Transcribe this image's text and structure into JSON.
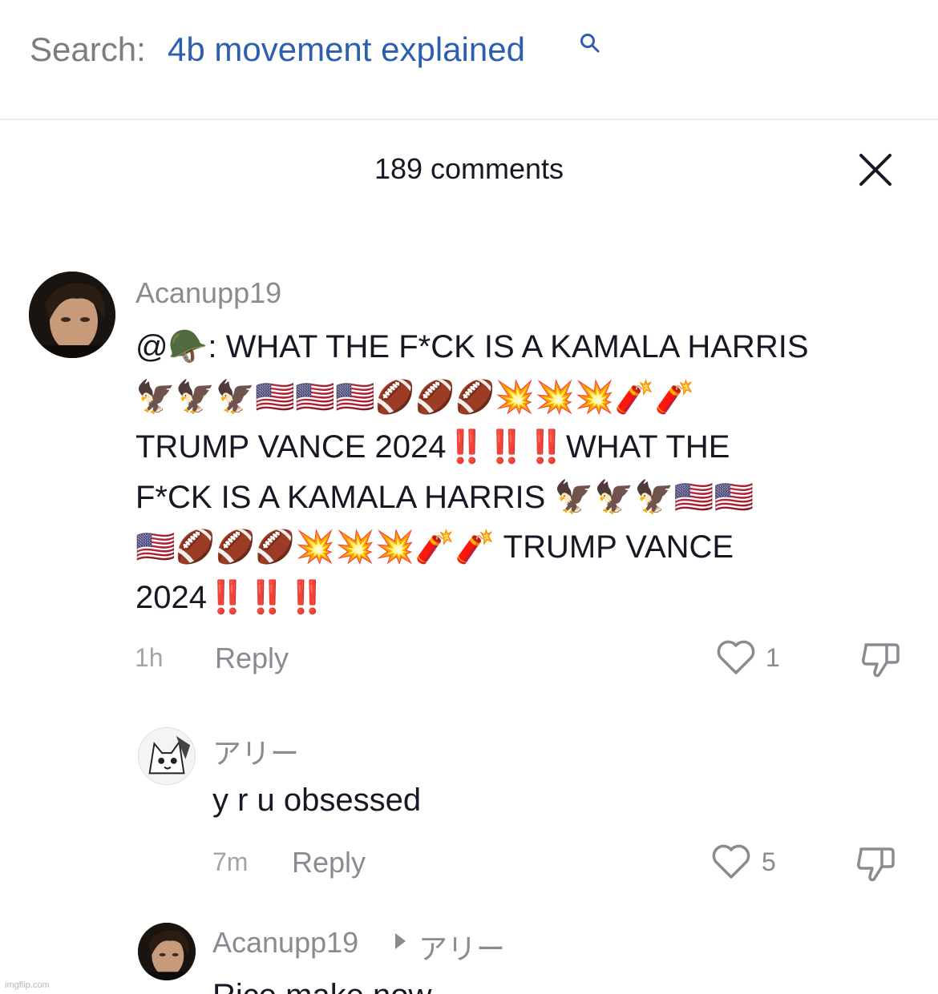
{
  "search": {
    "label": "Search:",
    "query": "4b movement explained"
  },
  "comments_header": {
    "title": "189 comments"
  },
  "comments": [
    {
      "username": "Acanupp19",
      "text_lines": [
        "@🪖: WHAT THE F*CK IS A KAMALA HARRIS",
        "🦅🦅🦅🇺🇸🇺🇸🇺🇸🏈🏈🏈💥💥💥🧨🧨",
        "TRUMP VANCE 2024‼️‼️‼️WHAT THE",
        "F*CK IS A KAMALA HARRIS 🦅🦅🦅🇺🇸🇺🇸",
        "🇺🇸🏈🏈🏈💥💥💥🧨🧨 TRUMP VANCE",
        "2024‼️‼️‼️"
      ],
      "time": "1h",
      "reply_label": "Reply",
      "likes": "1"
    },
    {
      "username": "アリー",
      "text": "y r u obsessed",
      "time": "7m",
      "reply_label": "Reply",
      "likes": "5"
    },
    {
      "username": "Acanupp19",
      "reply_to": "アリー",
      "text": "Rice make now"
    }
  ],
  "watermark": "imgflip.com",
  "colors": {
    "search_query": "#2c5fad",
    "muted_text": "#8a8b91",
    "primary_text": "#161823"
  },
  "icons": [
    "search-icon",
    "close-icon",
    "heart-icon",
    "thumbs-down-icon",
    "reply-arrow-icon"
  ]
}
